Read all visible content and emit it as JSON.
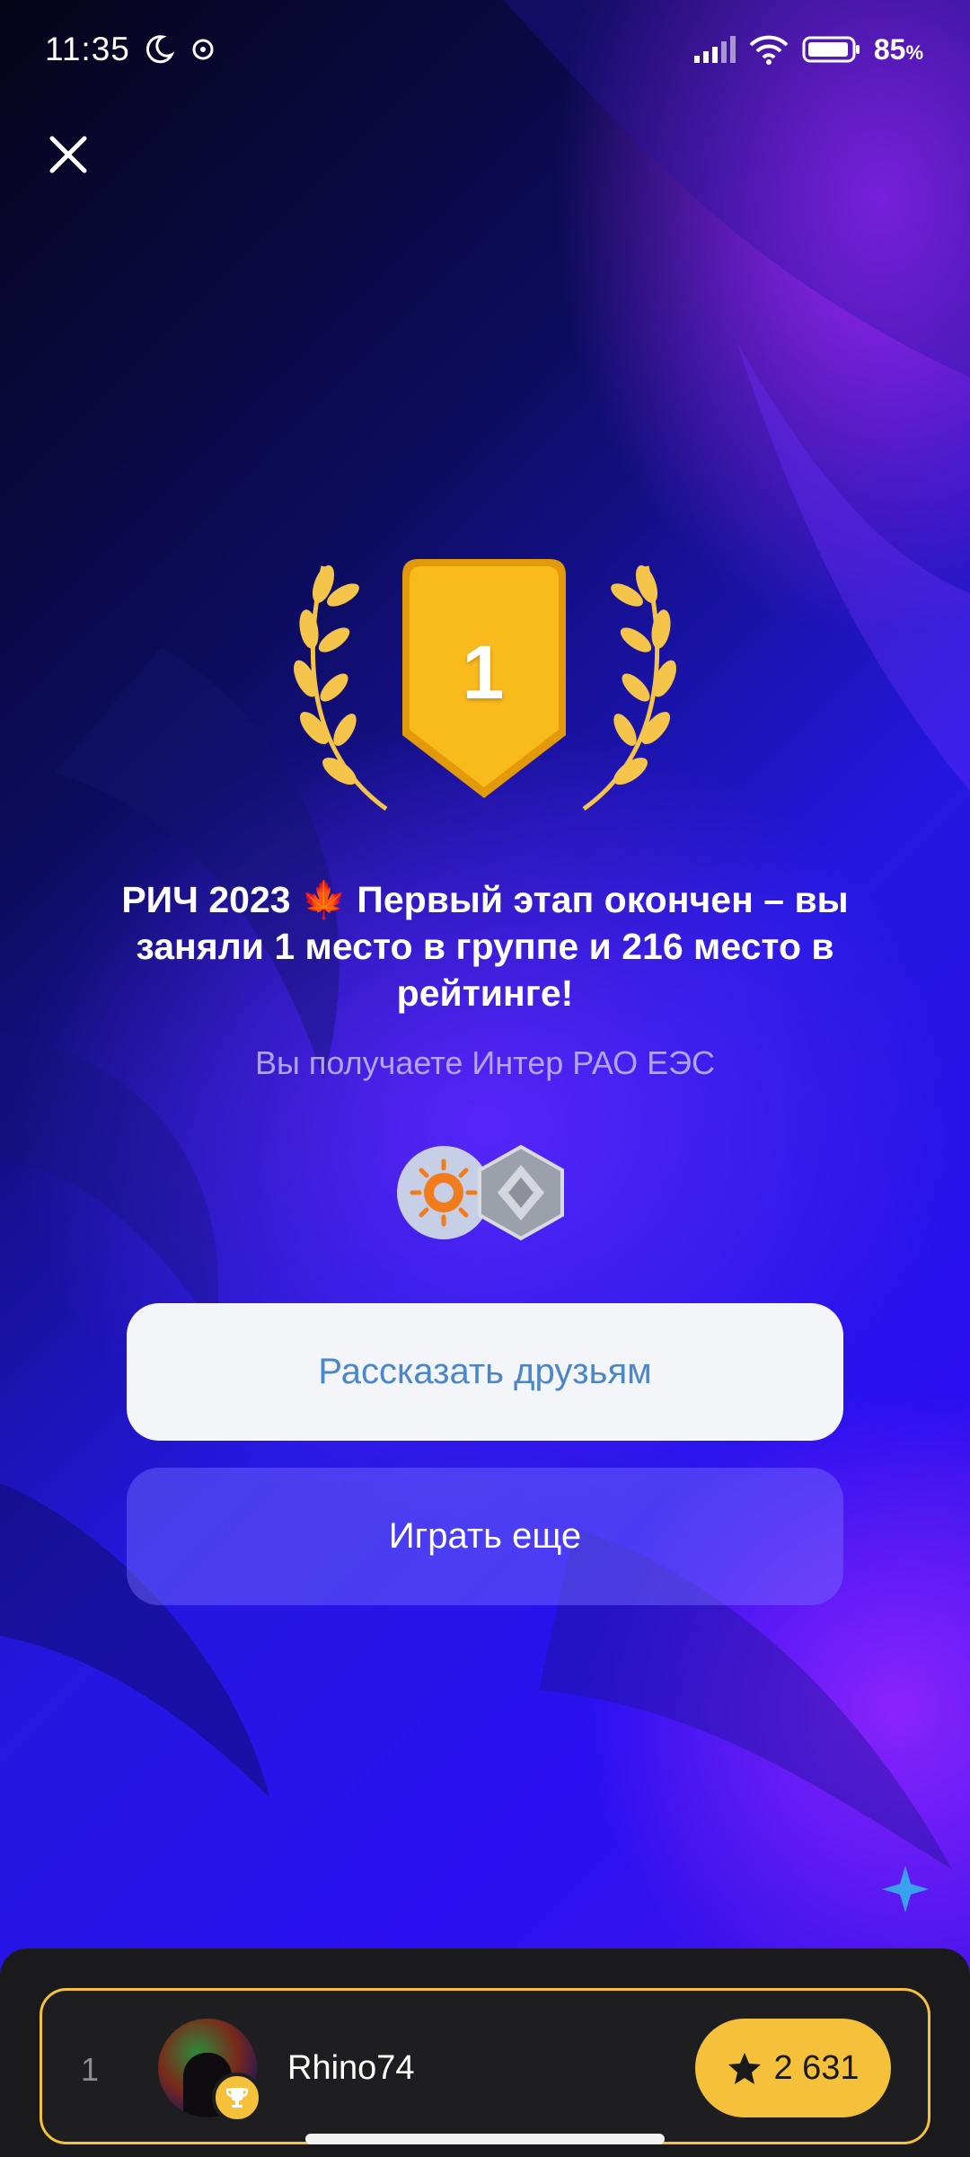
{
  "status_bar": {
    "time": "11:35",
    "battery": "85",
    "battery_unit": "%",
    "icons": [
      "moon-icon",
      "notification-icon",
      "signal-icon",
      "wifi-icon",
      "battery-icon"
    ]
  },
  "close_icon": "close-icon",
  "medal": {
    "place": "1",
    "colors": {
      "shield": "#f7b819",
      "laurel": "#f5c44a"
    }
  },
  "result": {
    "title": "РИЧ 2023 🍁 Первый этап окончен – вы заняли 1 место в группе и 216 место в рейтинге!",
    "subtitle": "Вы получаете Интер РАО ЕЭС"
  },
  "rewards": [
    "company-logo-icon",
    "rank-badge-icon"
  ],
  "buttons": {
    "share_label": "Рассказать друзьям",
    "play_again_label": "Играть еще"
  },
  "leaderboard": {
    "rank": "1",
    "username": "Rhino74",
    "score": "2 631",
    "score_icon": "star-icon",
    "badge_icon": "trophy-icon"
  },
  "colors": {
    "accent": "#f5c13a",
    "share_text": "#4a86c8",
    "panel": "#1a1a1c"
  }
}
